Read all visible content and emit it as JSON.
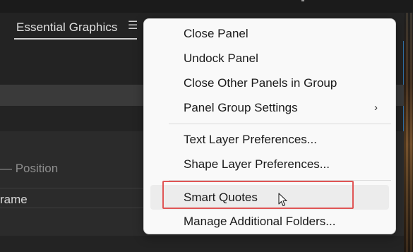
{
  "panel": {
    "tab_label": "Essential Graphics",
    "position_label": "— Position",
    "frame_label": "rame"
  },
  "menu": {
    "items": [
      {
        "label": "Close Panel"
      },
      {
        "label": "Undock Panel"
      },
      {
        "label": "Close Other Panels in Group"
      },
      {
        "label": "Panel Group Settings",
        "submenu_icon": "chevron-right-icon"
      },
      {
        "label": "Text Layer Preferences..."
      },
      {
        "label": "Shape Layer Preferences..."
      },
      {
        "label": "Smart Quotes",
        "state": "hover",
        "highlighted": true
      },
      {
        "label": "Manage Additional Folders..."
      }
    ],
    "submenu_glyph": "›"
  },
  "colors": {
    "panel_bg": "#232323",
    "panel_border_accent": "#2f6ea3",
    "menu_bg": "#f9f9f9",
    "highlight_box": "#e05555"
  },
  "icons": {
    "panel_menu": "hamburger-menu-icon",
    "cursor": "mouse-pointer-icon"
  }
}
